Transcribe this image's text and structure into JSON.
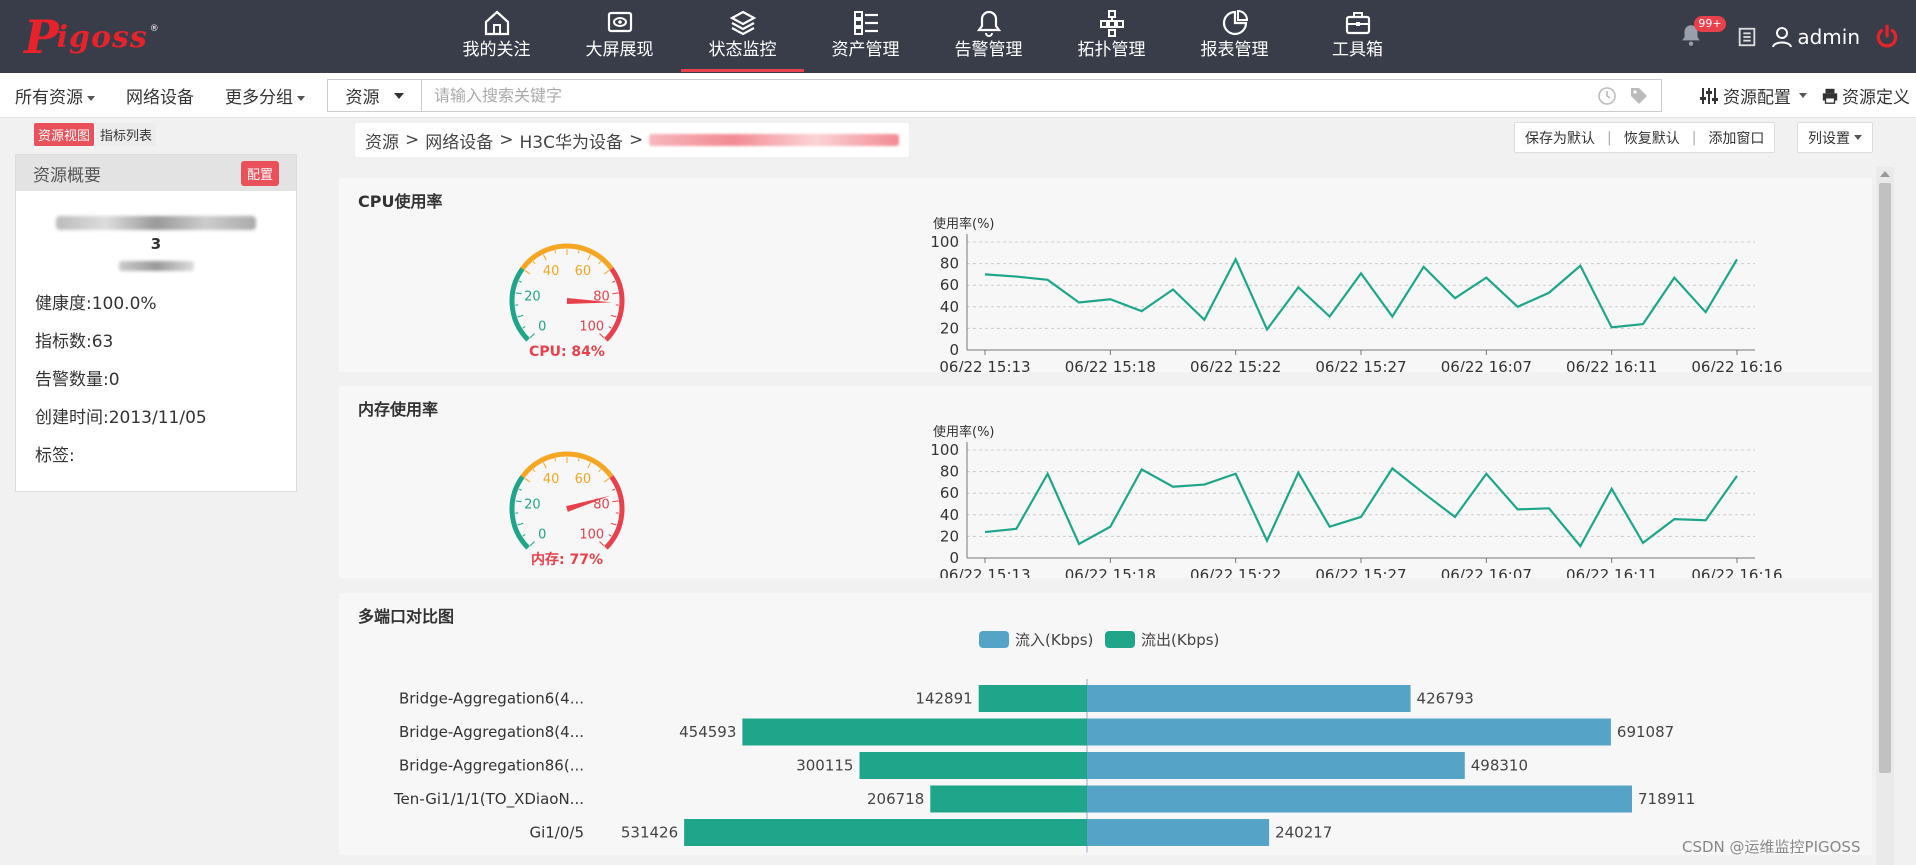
{
  "app": {
    "logo_letter": "P",
    "logo_rest": "igoss",
    "logo_reg": "®"
  },
  "nav": [
    {
      "label": "我的关注",
      "icon": "home-icon"
    },
    {
      "label": "大屏展现",
      "icon": "screen-eye-icon"
    },
    {
      "label": "状态监控",
      "icon": "layers-icon",
      "active": true
    },
    {
      "label": "资产管理",
      "icon": "list-icon"
    },
    {
      "label": "告警管理",
      "icon": "bell-icon"
    },
    {
      "label": "拓扑管理",
      "icon": "topology-icon"
    },
    {
      "label": "报表管理",
      "icon": "pie-chart-icon"
    },
    {
      "label": "工具箱",
      "icon": "toolbox-icon"
    }
  ],
  "top_right": {
    "badge": "99+",
    "user": "admin"
  },
  "subbar": {
    "left": [
      "所有资源",
      "网络设备",
      "更多分组"
    ],
    "search_type": "资源",
    "search_placeholder": "请输入搜索关键字",
    "right": [
      "资源配置",
      "资源定义"
    ]
  },
  "left_panel": {
    "tab_active": "资源视图",
    "tab_inactive": "指标列表",
    "title": "资源概要",
    "config_label": "配置",
    "name_suffix": "3",
    "rows": [
      "健康度:100.0%",
      "指标数:63",
      "告警数量:0",
      "创建时间:2013/11/05",
      "标签:"
    ]
  },
  "breadcrumb": {
    "items": [
      "资源",
      "网络设备",
      "H3C华为设备"
    ],
    "sep": ">"
  },
  "actions": {
    "save_default": "保存为默认",
    "restore_default": "恢复默认",
    "add_window": "添加窗口",
    "col_settings": "列设置"
  },
  "colors": {
    "accent": "#e8414c",
    "teal": "#1fa68a",
    "blue": "#55a3c7",
    "gauge_orange": "#f5a623",
    "gauge_red": "#e8414c",
    "gauge_green": "#1fa68a"
  },
  "watermark": "CSDN @运维监控PIGOSS",
  "chart_data": [
    {
      "type": "gauge",
      "title": "CPU使用率",
      "value": 84,
      "label": "CPU: 84%",
      "ticks": [
        "0",
        "20",
        "40",
        "60",
        "80",
        "100"
      ]
    },
    {
      "type": "line",
      "title": "CPU使用率",
      "ylabel": "使用率(%)",
      "ylim": [
        0,
        100
      ],
      "yticks": [
        0,
        20,
        40,
        60,
        80,
        100
      ],
      "xtick_labels": [
        "06/22 15:13",
        "06/22 15:18",
        "06/22 15:22",
        "06/22 15:27",
        "06/22 16:07",
        "06/22 16:11",
        "06/22 16:16"
      ],
      "values": [
        70,
        68,
        65,
        44,
        47,
        36,
        56,
        28,
        84,
        19,
        58,
        31,
        71,
        31,
        77,
        48,
        67,
        40,
        53,
        78,
        21,
        24,
        67,
        35,
        84
      ],
      "grid": true
    },
    {
      "type": "gauge",
      "title": "内存使用率",
      "value": 77,
      "label": "内存: 77%",
      "ticks": [
        "0",
        "20",
        "40",
        "60",
        "80",
        "100"
      ]
    },
    {
      "type": "line",
      "title": "内存使用率",
      "ylabel": "使用率(%)",
      "ylim": [
        0,
        100
      ],
      "yticks": [
        0,
        20,
        40,
        60,
        80,
        100
      ],
      "xtick_labels": [
        "06/22 15:13",
        "06/22 15:18",
        "06/22 15:22",
        "06/22 15:27",
        "06/22 16:07",
        "06/22 16:11",
        "06/22 16:16"
      ],
      "values": [
        24,
        27,
        78,
        13,
        29,
        82,
        66,
        68,
        78,
        16,
        79,
        29,
        38,
        83,
        60,
        38,
        78,
        45,
        46,
        11,
        64,
        14,
        36,
        35,
        76
      ],
      "grid": true
    },
    {
      "type": "bar",
      "title": "多端口对比图",
      "orientation": "horizontal-diverging",
      "series": [
        {
          "name": "流入(Kbps)",
          "color": "#55a3c7",
          "values": [
            426793,
            691087,
            498310,
            718911,
            240217
          ]
        },
        {
          "name": "流出(Kbps)",
          "color": "#1fa68a",
          "values": [
            142891,
            454593,
            300115,
            206718,
            531426
          ]
        }
      ],
      "categories": [
        "Bridge-Aggregation6(4...",
        "Bridge-Aggregation8(4...",
        "Bridge-Aggregation86(...",
        "Ten-Gi1/1/1(TO_XDiaoN...",
        "Gi1/0/5"
      ]
    }
  ]
}
